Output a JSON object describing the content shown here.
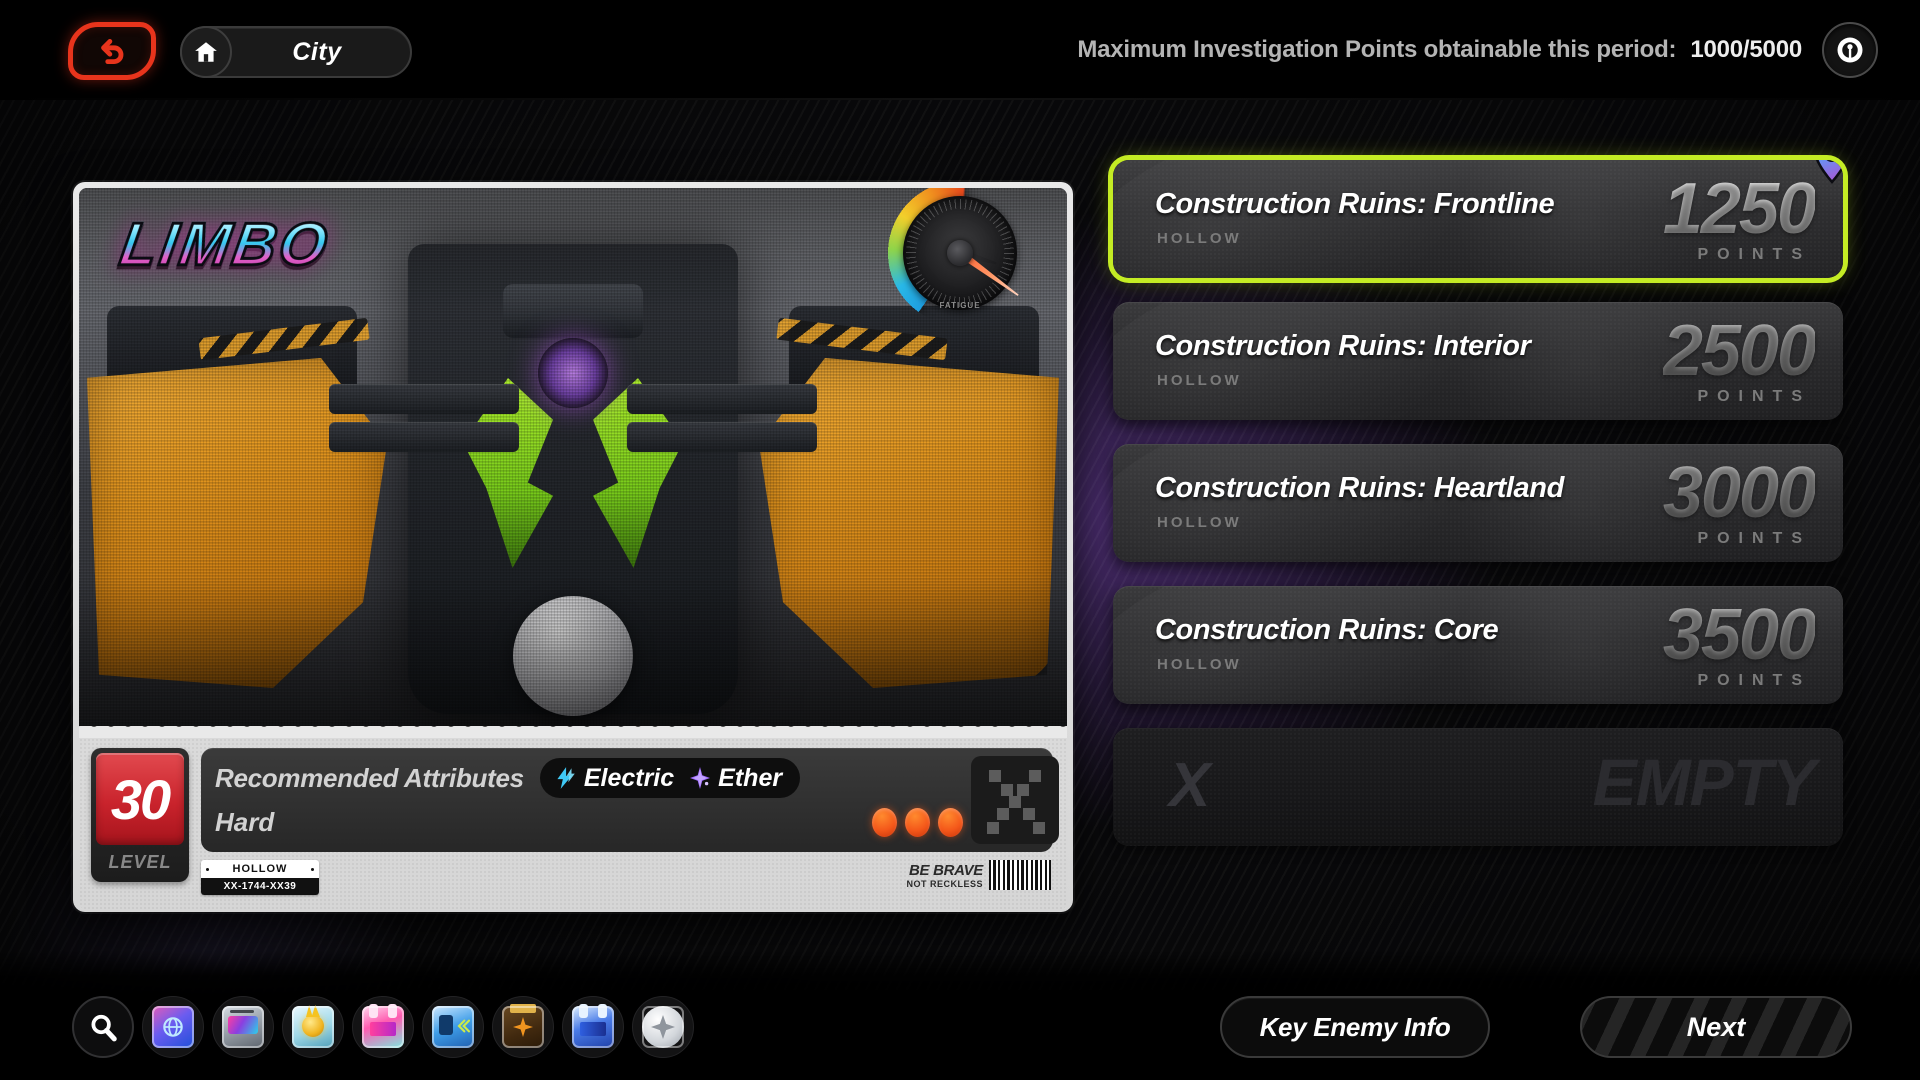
{
  "header": {
    "back_icon": "back-arrow-icon",
    "home_icon": "home-icon",
    "location_label": "City",
    "points_label": "Maximum Investigation Points obtainable this period:",
    "points_value": "1000/5000",
    "help_icon": "help-clock-icon"
  },
  "stage_card": {
    "logo": "LIMBO",
    "gauge": {
      "icon": "speedometer-gauge",
      "label": "FATIGUE",
      "needle_deg": 36
    },
    "level": {
      "value": "30",
      "label": "LEVEL"
    },
    "recommended_label": "Recommended Attributes",
    "attributes": [
      {
        "name": "Electric",
        "icon": "lightning-bolt-icon",
        "color": "#3fc9f5"
      },
      {
        "name": "Ether",
        "icon": "four-point-star-icon",
        "color": "#a06bff"
      }
    ],
    "difficulty_label": "Hard",
    "difficulty_filled": 3,
    "difficulty_total": 5,
    "qr_icon": "x-pattern-code",
    "plate": {
      "top": "HOLLOW",
      "bottom": "XX-1744-XX39"
    },
    "slogan": {
      "line1": "BE BRAVE",
      "line2": "NOT RECKLESS"
    },
    "barcode_icon": "barcode-icon"
  },
  "missions": [
    {
      "title": "Construction Ruins: Frontline",
      "subtitle": "HOLLOW",
      "points": "1250",
      "points_label": "POINTS",
      "selected": true,
      "pin_icon": "map-pin-icon"
    },
    {
      "title": "Construction Ruins: Interior",
      "subtitle": "HOLLOW",
      "points": "2500",
      "points_label": "POINTS",
      "selected": false
    },
    {
      "title": "Construction Ruins: Heartland",
      "subtitle": "HOLLOW",
      "points": "3000",
      "points_label": "POINTS",
      "selected": false
    },
    {
      "title": "Construction Ruins: Core",
      "subtitle": "HOLLOW",
      "points": "3500",
      "points_label": "POINTS",
      "selected": false
    },
    {
      "title": "",
      "subtitle": "",
      "points": "",
      "points_label": "",
      "empty": true,
      "x_mark": "X",
      "empty_label": "EMPTY"
    }
  ],
  "toolbar": [
    {
      "name": "search-icon"
    },
    {
      "name": "network-agent-icon"
    },
    {
      "name": "tablet-device-icon"
    },
    {
      "name": "currency-coin-icon"
    },
    {
      "name": "pink-agent-card-icon"
    },
    {
      "name": "blue-badge-icon"
    },
    {
      "name": "brown-pouch-icon"
    },
    {
      "name": "blue-agent-card-icon"
    },
    {
      "name": "white-emblem-icon"
    }
  ],
  "footer": {
    "key_enemy_label": "Key Enemy Info",
    "next_label": "Next"
  },
  "colors": {
    "accent_select": "#c4ec24",
    "back_red": "#e8341c",
    "level_red": "#c9232c",
    "difficulty_orange": "#f4581a",
    "electric_cyan": "#3fc9f5",
    "ether_purple": "#a06bff"
  }
}
